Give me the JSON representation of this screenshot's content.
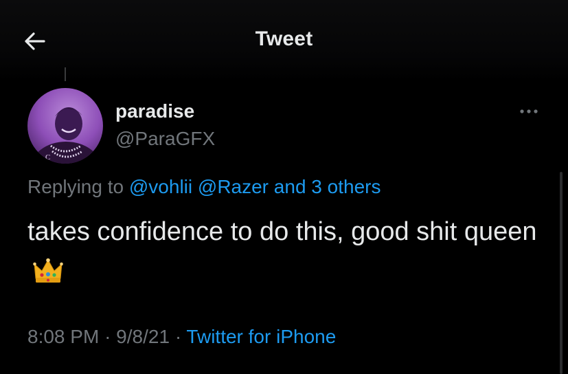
{
  "header": {
    "title": "Tweet"
  },
  "tweet": {
    "name": "paradise",
    "handle": "@ParaGFX",
    "replying_prefix": "Replying to",
    "mentions": [
      "@vohlii",
      "@Razer"
    ],
    "and_others": "and 3 others",
    "text": "takes confidence to do this, good shit queen",
    "emoji": "crown-emoji",
    "time": "8:08 PM",
    "date": "9/8/21",
    "source": "Twitter for iPhone",
    "separator": "·"
  },
  "colors": {
    "background": "#000000",
    "text": "#e7e9ea",
    "muted": "#71767b",
    "link": "#1d9bf0",
    "avatar_tint": "#8e4fb8"
  },
  "icons": {
    "back": "arrow-left-icon",
    "more": "more-horizontal-icon"
  }
}
